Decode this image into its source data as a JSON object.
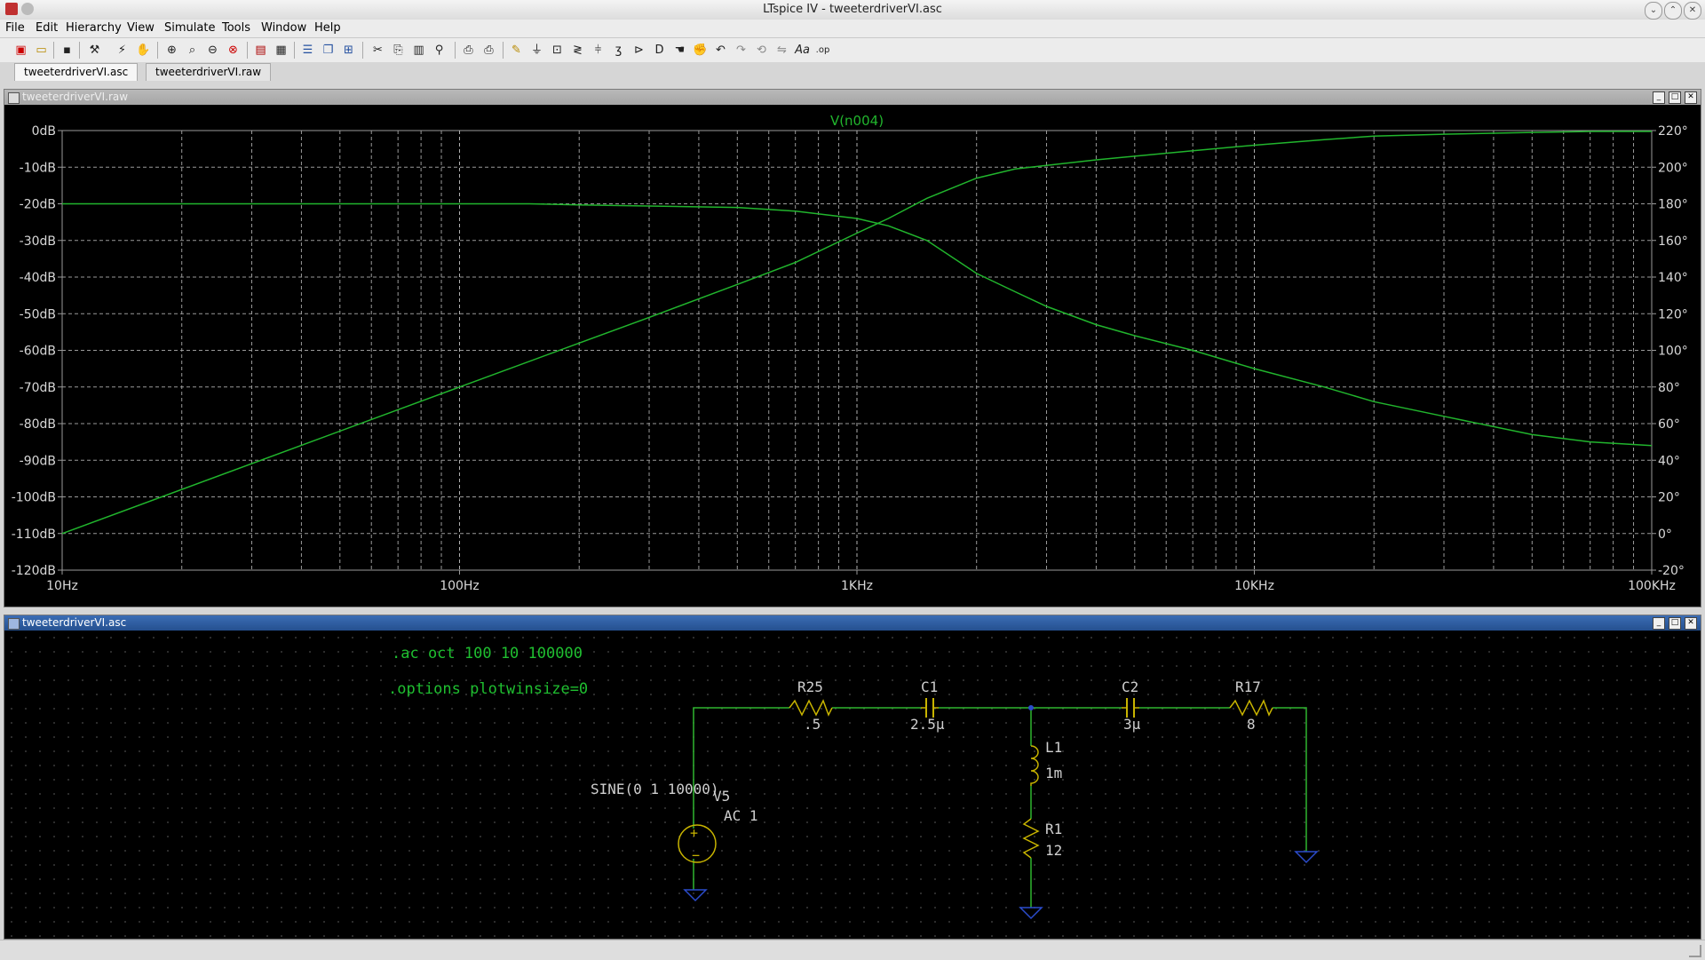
{
  "window": {
    "title": "LTspice IV - tweeterdriverVI.asc"
  },
  "menu": [
    "File",
    "Edit",
    "Hierarchy",
    "View",
    "Simulate",
    "Tools",
    "Window",
    "Help"
  ],
  "toolbar_icons": [
    "new-schematic-icon",
    "open-icon",
    "save-icon",
    "control-panel-icon",
    "run-icon",
    "halt-icon",
    "zoom-in-icon",
    "zoom-fit-icon",
    "zoom-out-icon",
    "zoom-cancel-icon",
    "autorange-icon",
    "print-icon",
    "tile-horizontal-icon",
    "cascade-icon",
    "tile-vertical-icon",
    "cut-icon",
    "copy-icon",
    "paste-icon",
    "find-icon",
    "print-setup-icon",
    "print-preview-icon",
    "draw-wire-icon",
    "ground-icon",
    "label-net-icon",
    "resistor-icon",
    "capacitor-icon",
    "inductor-icon",
    "diode-icon",
    "component-icon",
    "move-icon",
    "drag-icon",
    "undo-icon",
    "redo-icon",
    "rotate-icon",
    "mirror-icon",
    "text-icon",
    "spice-directive-icon"
  ],
  "tabs": [
    "tweeterdriverVI.asc",
    "tweeterdriverVI.raw"
  ],
  "plot_window": {
    "title": "tweeterdriverVI.raw"
  },
  "schematic_window": {
    "title": "tweeterdriverVI.asc"
  },
  "colors": {
    "trace": "#21b52d",
    "grid": "#9a9a9a",
    "axis_text": "#d8d8d8",
    "wire": "#2fb52f",
    "component": "#c8b400",
    "ground": "#2b4ccc",
    "directive": "#1fbf30",
    "label": "#cfcfcf"
  },
  "chart_data": {
    "type": "line",
    "title": "V(n004)",
    "x_scale": "log",
    "xlim": [
      10,
      100000
    ],
    "x_ticks": [
      10,
      100,
      1000,
      10000,
      100000
    ],
    "x_tick_labels": [
      "10Hz",
      "100Hz",
      "1KHz",
      "10KHz",
      "100KHz"
    ],
    "y_left": {
      "range": [
        -120,
        0
      ],
      "ticks": [
        0,
        -10,
        -20,
        -30,
        -40,
        -50,
        -60,
        -70,
        -80,
        -90,
        -100,
        -110,
        -120
      ],
      "tick_labels": [
        "0dB",
        "-10dB",
        "-20dB",
        "-30dB",
        "-40dB",
        "-50dB",
        "-60dB",
        "-70dB",
        "-80dB",
        "-90dB",
        "-100dB",
        "-110dB",
        "-120dB"
      ]
    },
    "y_right": {
      "range": [
        -20,
        220
      ],
      "ticks": [
        220,
        200,
        180,
        160,
        140,
        120,
        100,
        80,
        60,
        40,
        20,
        0,
        -20
      ],
      "tick_labels": [
        "220°",
        "200°",
        "180°",
        "160°",
        "140°",
        "120°",
        "100°",
        "80°",
        "60°",
        "40°",
        "20°",
        "0°",
        "-20°"
      ]
    },
    "grid": true,
    "series": [
      {
        "axis": "left",
        "x": [
          10,
          100,
          150,
          200,
          300,
          500,
          700,
          1000,
          1200,
          1500,
          2000,
          2500,
          3000,
          4000,
          5000,
          7000,
          10000,
          15000,
          20000,
          30000,
          50000,
          70000,
          100000
        ],
        "values": [
          -20,
          -20,
          -20,
          -20.3,
          -20.6,
          -21,
          -22,
          -24,
          -26,
          -30,
          -39,
          -44,
          -48,
          -53,
          -56,
          -60,
          -65,
          -70,
          -74,
          -78,
          -83,
          -85,
          -86
        ]
      },
      {
        "axis": "right",
        "x": [
          10,
          100,
          200,
          300,
          500,
          700,
          1000,
          1200,
          1500,
          2000,
          2500,
          3000,
          4000,
          5000,
          7000,
          10000,
          15000,
          20000,
          30000,
          50000,
          70000,
          100000
        ],
        "values": [
          0,
          80,
          104,
          118,
          136,
          148,
          164,
          172,
          183,
          194,
          199,
          201,
          204,
          206,
          209,
          212,
          215,
          217,
          218,
          219,
          219.5,
          219.5
        ]
      }
    ]
  },
  "schematic": {
    "directives": [
      ".ac oct 100 10 100000",
      ".options plotwinsize=0"
    ],
    "components": [
      {
        "ref": "R25",
        "value": ".5"
      },
      {
        "ref": "C1",
        "value": "2.5µ"
      },
      {
        "ref": "C2",
        "value": "3µ"
      },
      {
        "ref": "R17",
        "value": "8"
      },
      {
        "ref": "L1",
        "value": "1m"
      },
      {
        "ref": "R1",
        "value": "12"
      },
      {
        "ref": "V5",
        "value": "AC 1",
        "extra": "SINE(0 1 10000)"
      }
    ]
  }
}
